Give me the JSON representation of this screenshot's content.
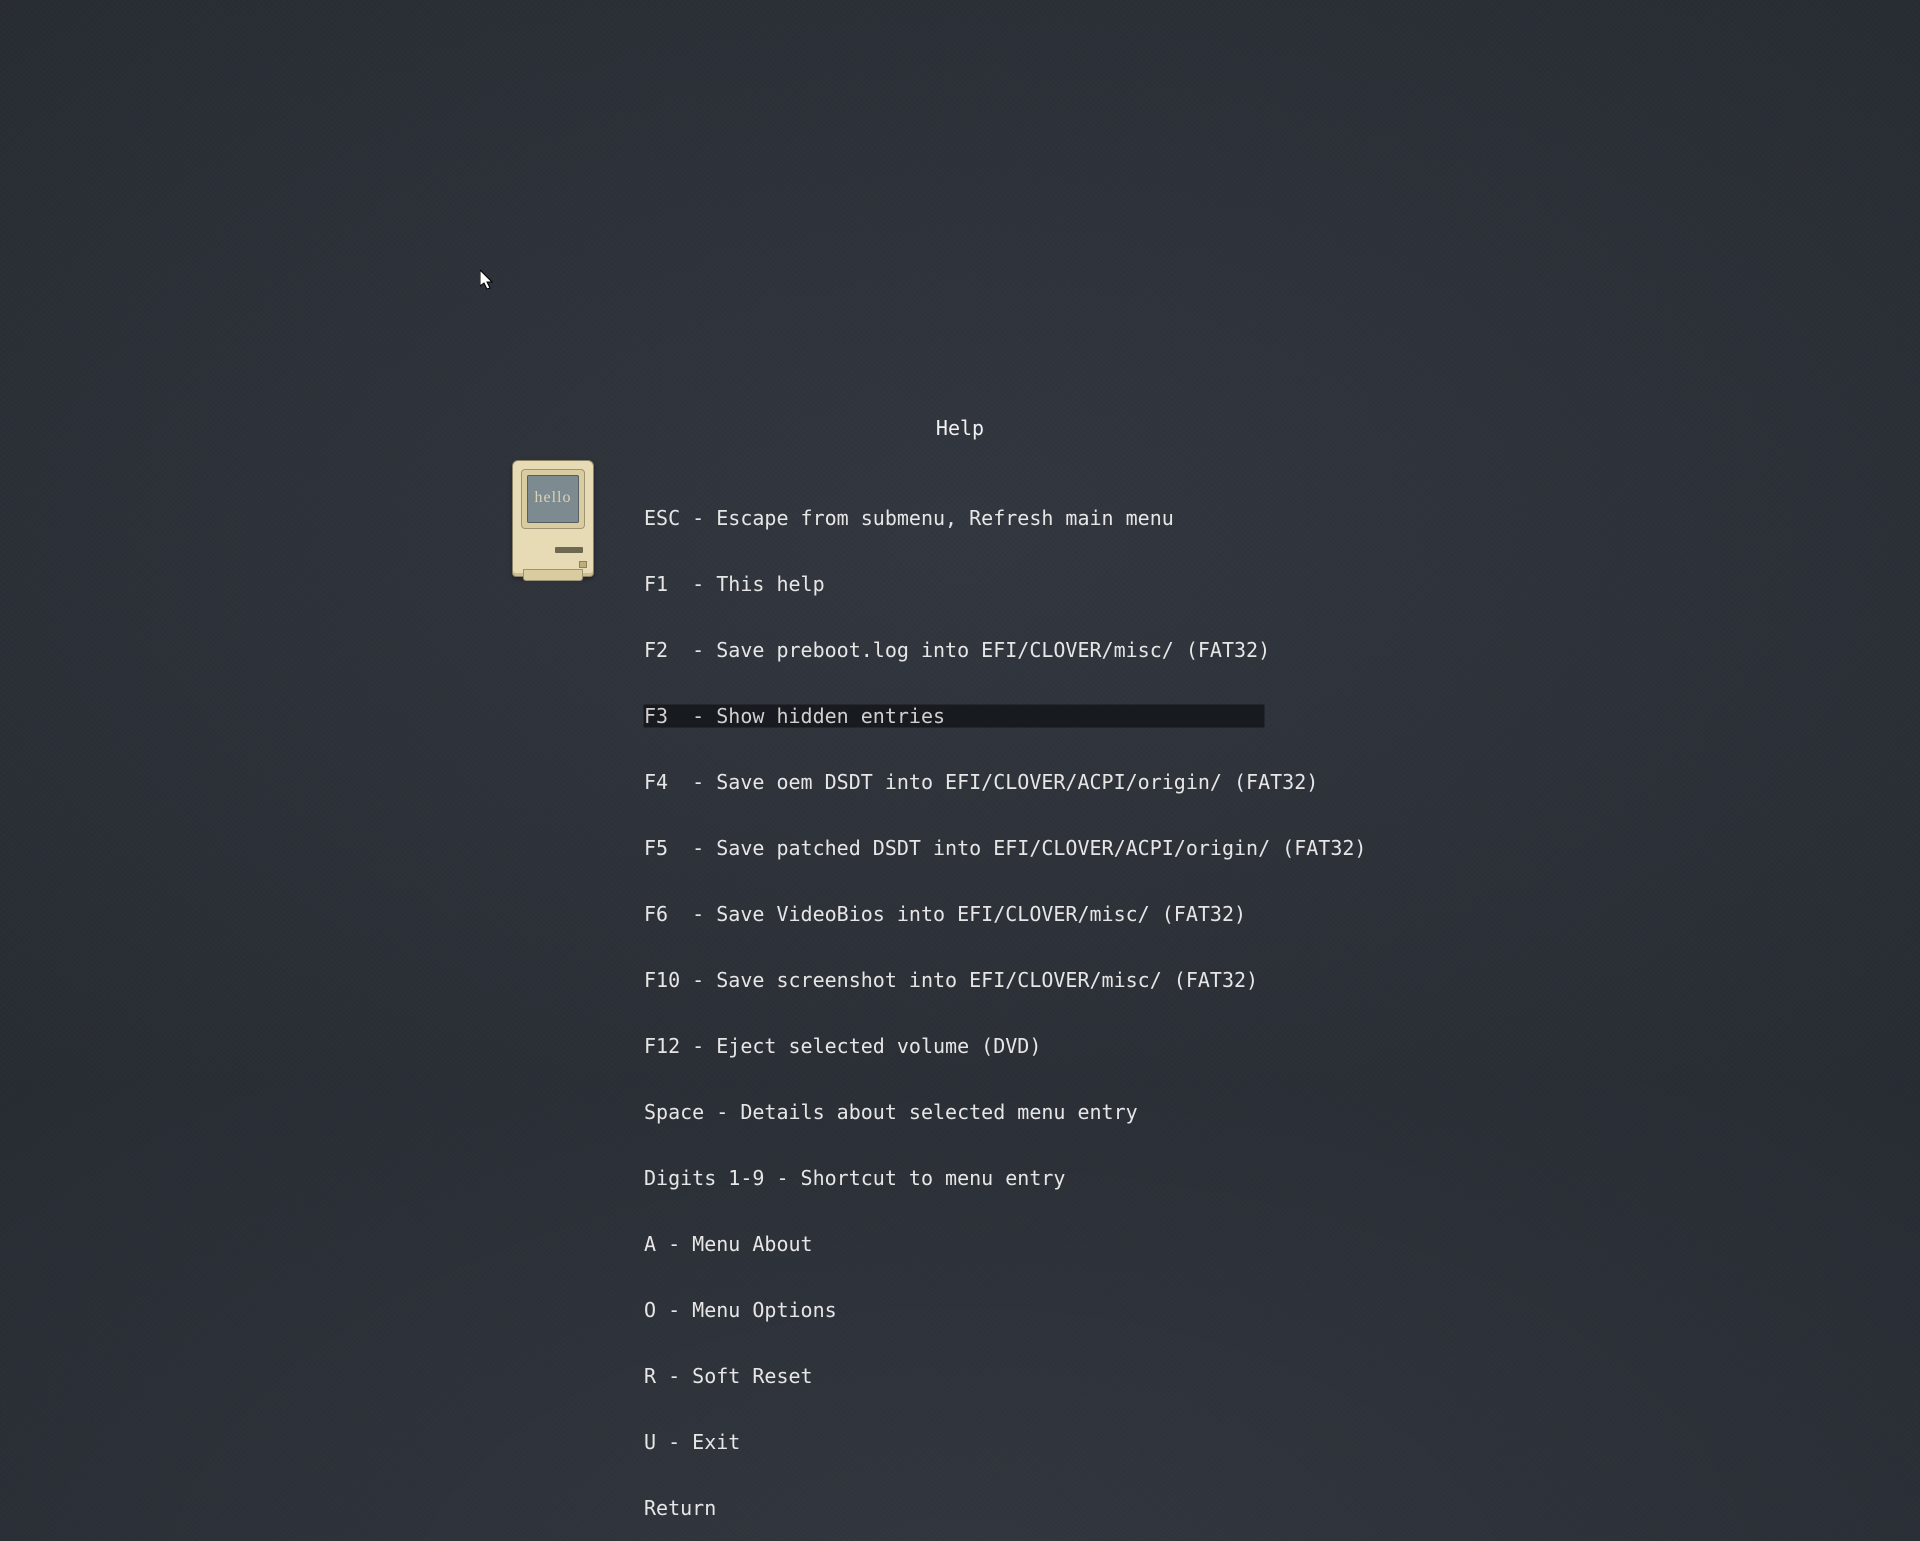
{
  "title": "Help",
  "icon": {
    "hello_text": "hello"
  },
  "selected_index": 3,
  "rows": [
    "ESC - Escape from submenu, Refresh main menu",
    "F1  - This help",
    "F2  - Save preboot.log into EFI/CLOVER/misc/ (FAT32)",
    "F3  - Show hidden entries",
    "F4  - Save oem DSDT into EFI/CLOVER/ACPI/origin/ (FAT32)",
    "F5  - Save patched DSDT into EFI/CLOVER/ACPI/origin/ (FAT32)",
    "F6  - Save VideoBios into EFI/CLOVER/misc/ (FAT32)",
    "F10 - Save screenshot into EFI/CLOVER/misc/ (FAT32)",
    "F12 - Eject selected volume (DVD)",
    "Space - Details about selected menu entry",
    "Digits 1-9 - Shortcut to menu entry",
    "A - Menu About",
    "O - Menu Options",
    "R - Soft Reset",
    "U - Exit",
    "Return"
  ]
}
